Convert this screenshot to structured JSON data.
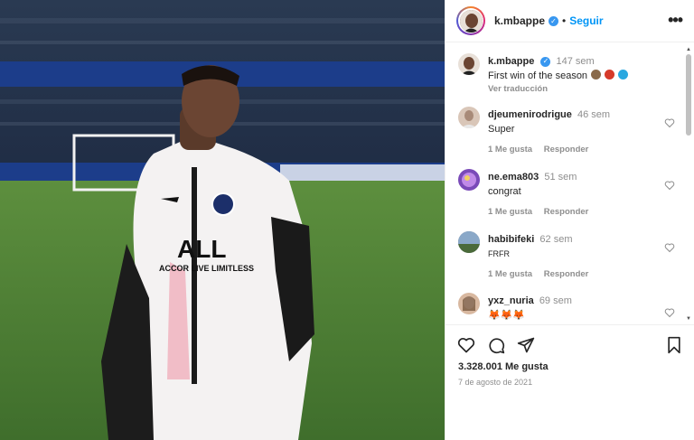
{
  "post": {
    "username": "k.mbappe",
    "follow_label": "Seguir",
    "dot": "•",
    "more_label": "•••",
    "jersey_brand": "ALL",
    "jersey_slogan": "ACCOR LIVE LIMITLESS"
  },
  "caption": {
    "username": "k.mbappe",
    "time": "147 sem",
    "text": "First win of the season",
    "translate_label": "Ver traducción",
    "emoji_colors": [
      "#8a6a4a",
      "#d63a2a",
      "#2aa8e0"
    ]
  },
  "comments": [
    {
      "username": "djeumenirodrigue",
      "time": "46 sem",
      "text": "Super",
      "likes_label": "1 Me gusta",
      "reply_label": "Responder",
      "avatar_color": "#d9c6b8"
    },
    {
      "username": "ne.ema803",
      "time": "51 sem",
      "text": "congrat",
      "likes_label": "1 Me gusta",
      "reply_label": "Responder",
      "avatar_color": "#7a4ab8"
    },
    {
      "username": "habibifeki",
      "time": "62 sem",
      "text": "FRFR",
      "likes_label": "1 Me gusta",
      "reply_label": "Responder",
      "avatar_color": "#5a6a7a"
    },
    {
      "username": "yxz_nuria",
      "time": "69 sem",
      "text": "🦊🦊🦊",
      "likes_label": "",
      "reply_label": "",
      "avatar_color": "#d8b8a0"
    }
  ],
  "stats": {
    "likes": "3.328.001 Me gusta",
    "date": "7 de agosto de 2021"
  },
  "colors": {
    "accent": "#0095f6",
    "verified": "#3897f0",
    "muted": "#8e8e8e"
  }
}
